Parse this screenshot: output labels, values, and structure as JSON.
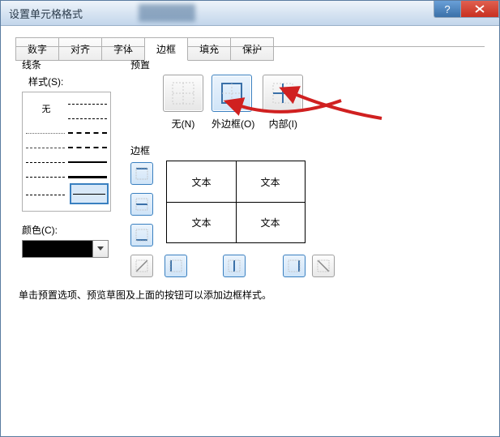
{
  "window": {
    "title": "设置单元格格式"
  },
  "tabs": {
    "number": "数字",
    "alignment": "对齐",
    "font": "字体",
    "border": "边框",
    "fill": "填充",
    "protection": "保护"
  },
  "line": {
    "section": "线条",
    "style_label": "样式(S):",
    "none": "无"
  },
  "color": {
    "label": "颜色(C):",
    "value": "#000000"
  },
  "preset": {
    "section": "预置",
    "none": "无(N)",
    "outline": "外边框(O)",
    "inside": "内部(I)"
  },
  "border_section": {
    "label": "边框",
    "sample_text": "文本"
  },
  "hint": "单击预置选项、预览草图及上面的按钮可以添加边框样式。"
}
